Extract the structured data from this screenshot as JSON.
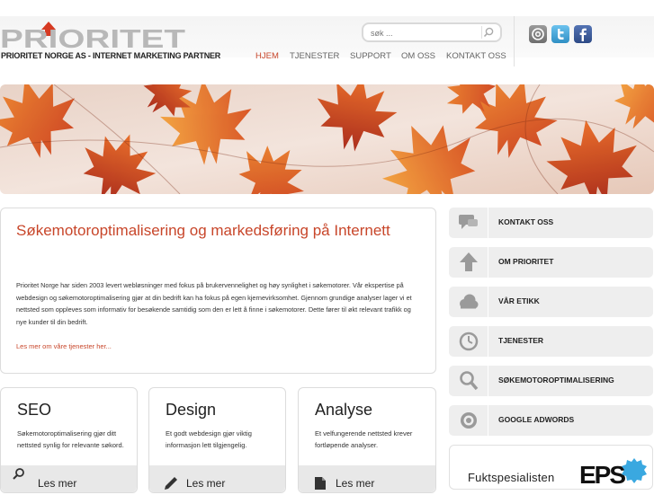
{
  "header": {
    "logo_text": "PRIORITET",
    "tagline": "PRIORITET NORGE AS - INTERNET MARKETING PARTNER",
    "search": {
      "placeholder": "søk ..."
    },
    "nav": [
      {
        "label": "HJEM",
        "active": true
      },
      {
        "label": "TJENESTER"
      },
      {
        "label": "SUPPORT"
      },
      {
        "label": "OM OSS"
      },
      {
        "label": "KONTAKT OSS"
      }
    ],
    "social": [
      {
        "name": "email-icon",
        "label": "@"
      },
      {
        "name": "twitter-icon",
        "label": "t"
      },
      {
        "name": "facebook-icon",
        "label": "f"
      }
    ]
  },
  "main": {
    "title": "Søkemotoroptimalisering og markedsføring på Internett",
    "body": "Prioritet Norge har siden 2003 levert webløsninger med fokus på brukervennelighet og høy synlighet i søkemotorer. Vår ekspertise på webdesign og søkemotoroptimalisering gjør at din bedrift kan ha fokus på egen kjernevirksomhet. Gjennom grundige analyser lager vi et nettsted som oppleves som informativ for besøkende samtidig som den er lett å finne i søkemotorer. Dette fører til økt relevant trafikk og nye kunder til din bedrift.",
    "link": "Les mer om våre tjenester her..."
  },
  "cards": [
    {
      "title": "SEO",
      "text": "Søkemotoroptimalisering gjør ditt nettsted synlig for relevante søkord.",
      "more": "Les mer",
      "icon": "search-icon"
    },
    {
      "title": "Design",
      "text": "Et godt webdesign gjør viktig informasjon lett tilgjengelig.",
      "more": "Les mer",
      "icon": "pencil-icon"
    },
    {
      "title": "Analyse",
      "text": "Et velfungerende nettsted krever fortløpende analyser.",
      "more": "Les mer",
      "icon": "document-icon"
    }
  ],
  "sidebar": [
    {
      "label": "KONTAKT OSS",
      "icon": "chat-icon"
    },
    {
      "label": "OM PRIORITET",
      "icon": "arrow-up-icon"
    },
    {
      "label": "VÅR ETIKK",
      "icon": "cloud-icon"
    },
    {
      "label": "TJENESTER",
      "icon": "clock-icon"
    },
    {
      "label": "SØKEMOTOROPTIMALISERING",
      "icon": "magnifier-icon"
    },
    {
      "label": "GOOGLE ADWORDS",
      "icon": "target-icon"
    }
  ],
  "partners": {
    "left": "Fuktspesialisten",
    "right": "EPS"
  },
  "colors": {
    "accent": "#c8462a",
    "sidebar_bg": "#eeeeee",
    "icon_gray": "#9a9a9a",
    "twitter": "#4aa6d6",
    "facebook": "#3b5a9a"
  }
}
